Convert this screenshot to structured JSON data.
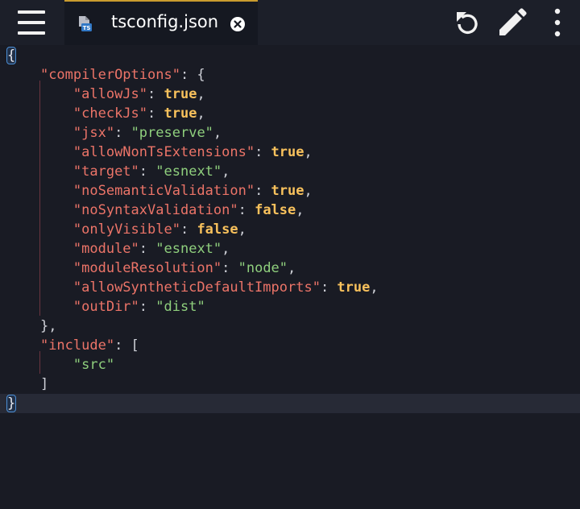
{
  "app": {
    "tab": {
      "title": "tsconfig.json",
      "file_icon": "typescript-file-icon"
    },
    "actions": [
      "undo-icon",
      "pencil-icon",
      "more-vertical-icon"
    ]
  },
  "colors": {
    "background": "#191b24",
    "key": "#ec7468",
    "string": "#8fcf7d",
    "boolean": "#f8c15c",
    "punctuation": "#cfd1d8",
    "tab_accent": "#c99b2e",
    "bracket_match": "#4b8fd6"
  },
  "code": {
    "open_brace": "{",
    "compiler_options_key": "\"compilerOptions\"",
    "compiler_options_open": ": {",
    "entries": [
      {
        "key": "\"allowJs\"",
        "sep": ": ",
        "value": "true",
        "value_type": "boolean",
        "trail": ","
      },
      {
        "key": "\"checkJs\"",
        "sep": ": ",
        "value": "true",
        "value_type": "boolean",
        "trail": ","
      },
      {
        "key": "\"jsx\"",
        "sep": ": ",
        "value": "\"preserve\"",
        "value_type": "string",
        "trail": ","
      },
      {
        "key": "\"allowNonTsExtensions\"",
        "sep": ": ",
        "value": "true",
        "value_type": "boolean",
        "trail": ","
      },
      {
        "key": "\"target\"",
        "sep": ": ",
        "value": "\"esnext\"",
        "value_type": "string",
        "trail": ","
      },
      {
        "key": "\"noSemanticValidation\"",
        "sep": ": ",
        "value": "true",
        "value_type": "boolean",
        "trail": ","
      },
      {
        "key": "\"noSyntaxValidation\"",
        "sep": ": ",
        "value": "false",
        "value_type": "boolean",
        "trail": ","
      },
      {
        "key": "\"onlyVisible\"",
        "sep": ": ",
        "value": "false",
        "value_type": "boolean",
        "trail": ","
      },
      {
        "key": "\"module\"",
        "sep": ": ",
        "value": "\"esnext\"",
        "value_type": "string",
        "trail": ","
      },
      {
        "key": "\"moduleResolution\"",
        "sep": ": ",
        "value": "\"node\"",
        "value_type": "string",
        "trail": ","
      },
      {
        "key": "\"allowSyntheticDefaultImports\"",
        "sep": ": ",
        "value": "true",
        "value_type": "boolean",
        "trail": ","
      },
      {
        "key": "\"outDir\"",
        "sep": ": ",
        "value": "\"dist\"",
        "value_type": "string",
        "trail": ""
      }
    ],
    "compiler_options_close": "},",
    "include_key": "\"include\"",
    "include_open": ": [",
    "include_item": "\"src\"",
    "include_close": "]",
    "close_brace": "}"
  }
}
